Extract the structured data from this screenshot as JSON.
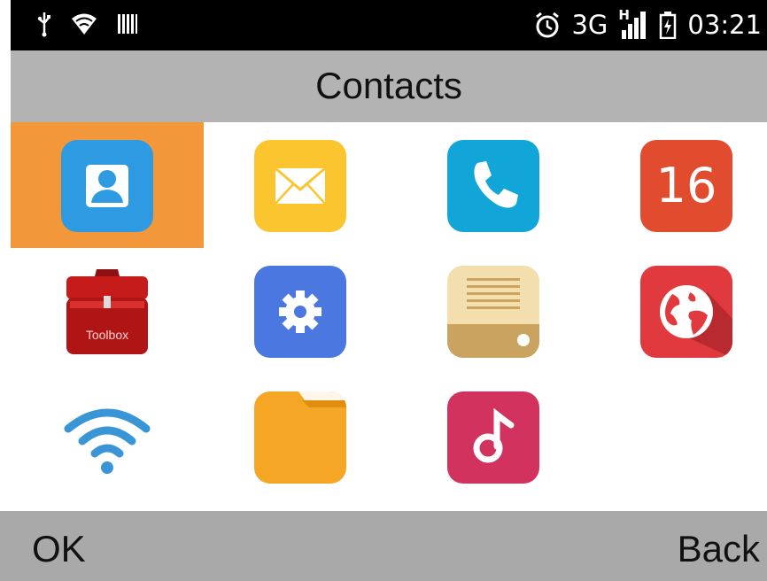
{
  "status": {
    "network": "3G",
    "signal_mark": "H",
    "time": "03:21",
    "icons": [
      "usb-icon",
      "wifi-icon",
      "barcode-icon",
      "alarm-icon",
      "signal-icon",
      "battery-icon"
    ]
  },
  "header": {
    "title": "Contacts"
  },
  "apps": [
    {
      "name": "contacts",
      "icon": "contact-icon",
      "selected": true
    },
    {
      "name": "messages",
      "icon": "envelope-icon"
    },
    {
      "name": "phone",
      "icon": "phone-icon"
    },
    {
      "name": "calendar",
      "icon": "calendar-icon",
      "label": "16"
    },
    {
      "name": "toolbox",
      "icon": "toolbox-icon",
      "label": "Toolbox"
    },
    {
      "name": "settings",
      "icon": "gear-icon"
    },
    {
      "name": "radio",
      "icon": "radio-icon"
    },
    {
      "name": "browser",
      "icon": "globe-icon"
    },
    {
      "name": "wifi",
      "icon": "wifi-icon"
    },
    {
      "name": "files",
      "icon": "folder-icon"
    },
    {
      "name": "music",
      "icon": "music-note-icon"
    }
  ],
  "softkeys": {
    "left": "OK",
    "right": "Back"
  },
  "colors": {
    "selected": "#f2973a",
    "bars": "#b3b3b3"
  }
}
